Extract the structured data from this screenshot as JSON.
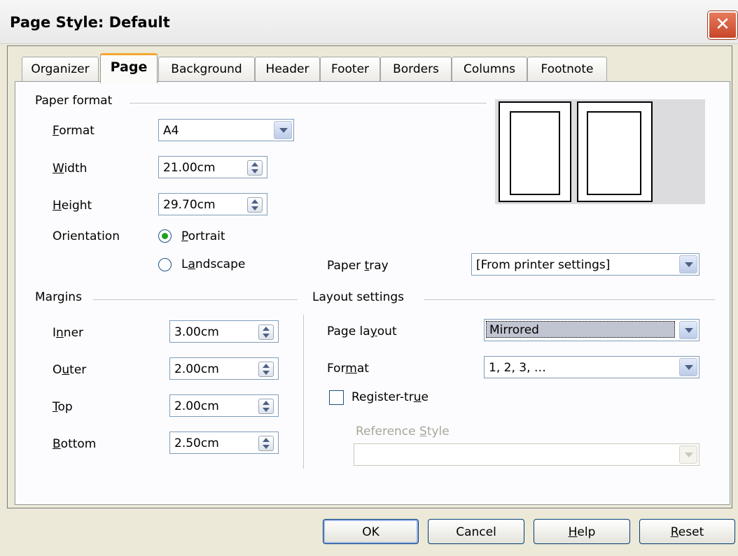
{
  "window": {
    "title": "Page Style: Default",
    "close_symbol": "✕"
  },
  "tabs": [
    {
      "label": "Organizer"
    },
    {
      "label": "Page"
    },
    {
      "label": "Background"
    },
    {
      "label": "Header"
    },
    {
      "label": "Footer"
    },
    {
      "label": "Borders"
    },
    {
      "label": "Columns"
    },
    {
      "label": "Footnote"
    }
  ],
  "paper_format": {
    "group_label": "Paper format",
    "format": {
      "label": "Format",
      "value": "A4"
    },
    "width": {
      "label": "Width",
      "value": "21.00cm"
    },
    "height": {
      "label": "Height",
      "value": "29.70cm"
    },
    "orientation": {
      "label": "Orientation",
      "portrait": "Portrait",
      "landscape": "Landscape",
      "selected": "Portrait"
    },
    "paper_tray": {
      "label": "Paper tray",
      "value": "[From printer settings]"
    }
  },
  "margins": {
    "group_label": "Margins",
    "inner": {
      "label": "Inner",
      "value": "3.00cm"
    },
    "outer": {
      "label": "Outer",
      "value": "2.00cm"
    },
    "top": {
      "label": "Top",
      "value": "2.00cm"
    },
    "bottom": {
      "label": "Bottom",
      "value": "2.50cm"
    }
  },
  "layout": {
    "group_label": "Layout settings",
    "page_layout": {
      "label": "Page layout",
      "value": "Mirrored"
    },
    "format": {
      "label": "Format",
      "value": "1, 2, 3, …"
    },
    "register_true": {
      "label": "Register-true",
      "checked": false
    },
    "reference_style": {
      "label": "Reference Style",
      "value": ""
    }
  },
  "buttons": {
    "ok": "OK",
    "cancel": "Cancel",
    "help": "Help",
    "reset": "Reset"
  },
  "colors": {
    "accent_tab": "#f4a52e",
    "panel_bg": "#fcfcfe",
    "dialog_bg": "#ece9d8"
  }
}
